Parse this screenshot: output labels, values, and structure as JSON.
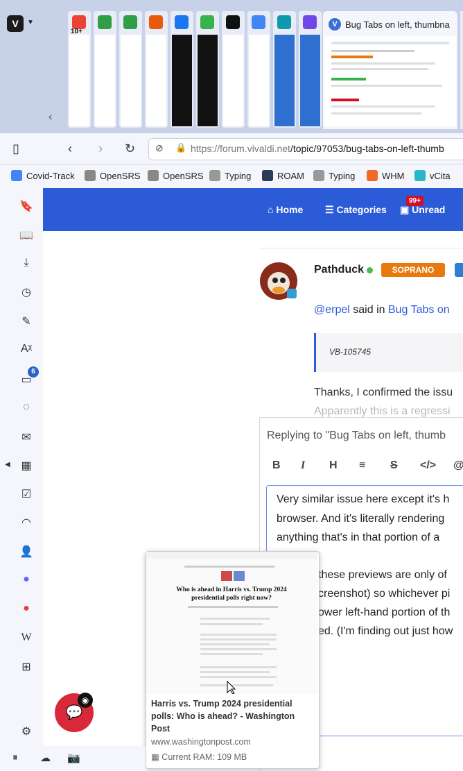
{
  "browser": {
    "tabs": {
      "stacks": [
        {
          "icon": "gmail-icon",
          "badge": "10+",
          "color": "#ea4335"
        },
        {
          "icon": "phone-icon",
          "color": "#2f9e44"
        },
        {
          "icon": "phone-icon",
          "color": "#2f9e44"
        },
        {
          "icon": "ubiquiti-icon",
          "color": "#e8590c"
        },
        {
          "icon": "facebook-icon",
          "color": "#1877f2"
        },
        {
          "icon": "newsletter-icon",
          "color": "#37b24d"
        },
        {
          "icon": "washington-post-icon",
          "color": "#111111"
        },
        {
          "icon": "google-home-icon",
          "color": "#4285f4"
        },
        {
          "icon": "n-app-icon",
          "color": "#1098ad"
        },
        {
          "icon": "whmcs-icon",
          "color": "#7048e8"
        }
      ],
      "active_title": "Bug Tabs on left, thumbna"
    },
    "address": {
      "url_host": "https://forum.vivaldi.net",
      "url_path": "/topic/97053/bug-tabs-on-left-thumb"
    },
    "bookmarks": [
      {
        "label": "Covid-Track",
        "icon": "google-icon",
        "color": "#4285f4"
      },
      {
        "label": "OpenSRS",
        "icon": "page-icon",
        "color": "#888888"
      },
      {
        "label": "OpenSRS",
        "icon": "page-icon",
        "color": "#888888"
      },
      {
        "label": "Typing",
        "icon": "typing-icon",
        "color": "#999999"
      },
      {
        "label": "ROAM",
        "icon": "roam-icon",
        "color": "#2b3a55"
      },
      {
        "label": "Typing",
        "icon": "typing-icon",
        "color": "#999999"
      },
      {
        "label": "WHM",
        "icon": "cpanel-icon",
        "color": "#f06a25"
      },
      {
        "label": "vCita",
        "icon": "vcita-icon",
        "color": "#28b6c8"
      }
    ],
    "side_panel_badge": "6"
  },
  "forum": {
    "nav": {
      "home": "Home",
      "categories": "Categories",
      "unread": "Unread",
      "unread_badge": "99+"
    },
    "post": {
      "author": "Pathduck",
      "role_badge": "SOPRANO",
      "said_user": "@erpel",
      "said_in": "said in",
      "said_link": "Bug Tabs on",
      "quote": "VB-105745",
      "text": "Thanks, I confirmed the issu",
      "text_faded": "Apparently this is a regressi"
    },
    "composer": {
      "replying": "Replying to \"Bug Tabs on left, thumb",
      "toolbar": [
        "B",
        "I",
        "H",
        "≡",
        "S",
        "</>",
        "@"
      ],
      "lines": [
        "Very similar issue here except it's h",
        "browser. And it's literally rendering",
        "anything that's in that portion of a",
        "",
        "these previews are only of",
        "creenshot) so whichever pi",
        "ower left-hand portion of th",
        "ed. (I'm finding out just how"
      ]
    }
  },
  "preview": {
    "title": "Harris vs. Trump 2024 presidential polls: Who is ahead? - Washington Post",
    "url": "www.washingtonpost.com",
    "ram": "Current RAM: 109 MB",
    "headline": "Who is ahead in Harris vs. Trump 2024 presidential polls right now?"
  }
}
